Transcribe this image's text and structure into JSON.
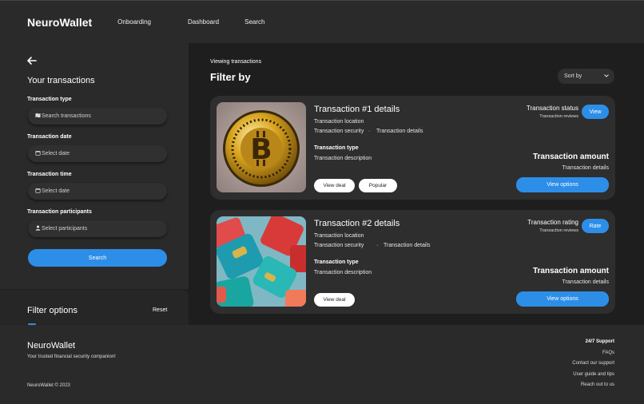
{
  "header": {
    "brand": "NeuroWallet",
    "nav": [
      "Onboarding",
      "Dashboard",
      "Search"
    ]
  },
  "sidebar": {
    "back_icon": "arrow-left-icon",
    "title": "Your transactions",
    "fields": [
      {
        "label": "Transaction type",
        "icon": "map-icon",
        "placeholder": "Search transactions"
      },
      {
        "label": "Transaction date",
        "icon": "calendar-icon",
        "placeholder": "Select date"
      },
      {
        "label": "Transaction time",
        "icon": "calendar-icon",
        "placeholder": "Select date"
      },
      {
        "label": "Transaction participants",
        "icon": "person-icon",
        "placeholder": "Select participants"
      }
    ],
    "search_button": "Search"
  },
  "filter_panel": {
    "title": "Filter options",
    "reset": "Reset"
  },
  "main": {
    "eyebrow": "Viewing transactions",
    "title": "Filter by",
    "sort_label": "Sort by"
  },
  "cards": [
    {
      "title": "Transaction #1 details",
      "location": "Transaction location",
      "security": "Transaction security",
      "details": "Transaction details",
      "type": "Transaction type",
      "description": "Transaction description",
      "pill1": "View deal",
      "pill2": "Popular",
      "status_title": "Transaction status",
      "status_sub": "Transaction reviews",
      "small_button": "View",
      "amount": "Transaction amount",
      "amount_sub": "Transaction details",
      "options_button": "View options"
    },
    {
      "title": "Transaction #2 details",
      "location": "Transaction location",
      "security": "Transaction security",
      "details": "Transaction details",
      "type": "Transaction type",
      "description": "Transaction description",
      "pill1": "View deal",
      "status_title": "Transaction rating",
      "status_sub": "Transaction reviews",
      "small_button": "Rate",
      "amount": "Transaction amount",
      "amount_sub": "Transaction details",
      "options_button": "View options"
    }
  ],
  "footer": {
    "brand": "NeuroWallet",
    "tagline": "Your trusted financial security companion!",
    "copyright": "NeuroWallet © 2023",
    "links_heading": "24/7 Support",
    "links": [
      "FAQs",
      "Contact our support",
      "User guide and tips",
      "Reach out to us"
    ]
  },
  "colors": {
    "accent": "#2d8ee8",
    "background": "#1e1e1e",
    "panel": "#2a2a2a"
  }
}
